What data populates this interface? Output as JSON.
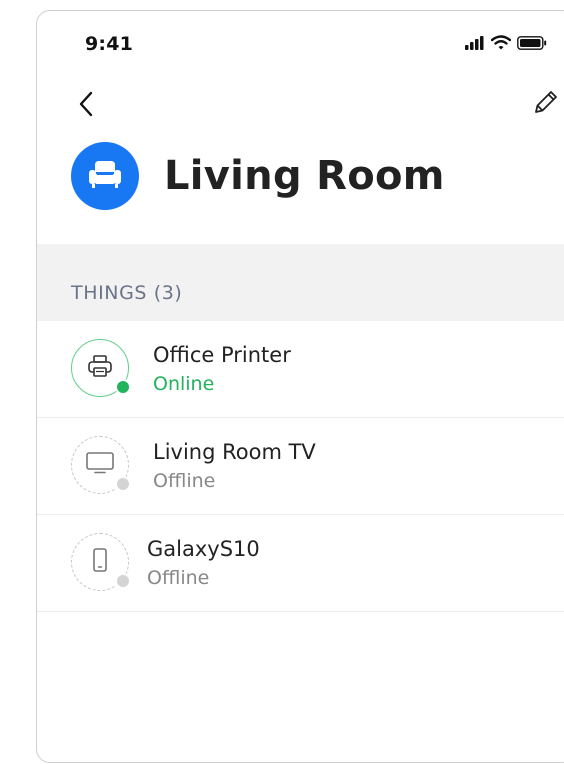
{
  "status_bar": {
    "time": "9:41",
    "icons": [
      "signal-icon",
      "wifi-icon",
      "battery-icon"
    ]
  },
  "nav": {
    "back_icon": "chevron-left-icon",
    "edit_icon": "pencil-icon"
  },
  "room": {
    "title": "Living Room",
    "icon": "armchair-icon",
    "icon_color": "#1877f2"
  },
  "section": {
    "label": "THINGS (3)"
  },
  "devices": [
    {
      "name": "Office Printer",
      "status": "Online",
      "icon": "printer-icon",
      "state": "online"
    },
    {
      "name": "Living Room TV",
      "status": "Offline",
      "icon": "tv-icon",
      "state": "offline"
    },
    {
      "name": "GalaxyS10",
      "status": "Offline",
      "icon": "phone-icon",
      "state": "offline"
    }
  ],
  "colors": {
    "online": "#22b35d",
    "offline_text": "#888888",
    "section_bg": "#f2f2f2",
    "section_text": "#6a7489"
  }
}
